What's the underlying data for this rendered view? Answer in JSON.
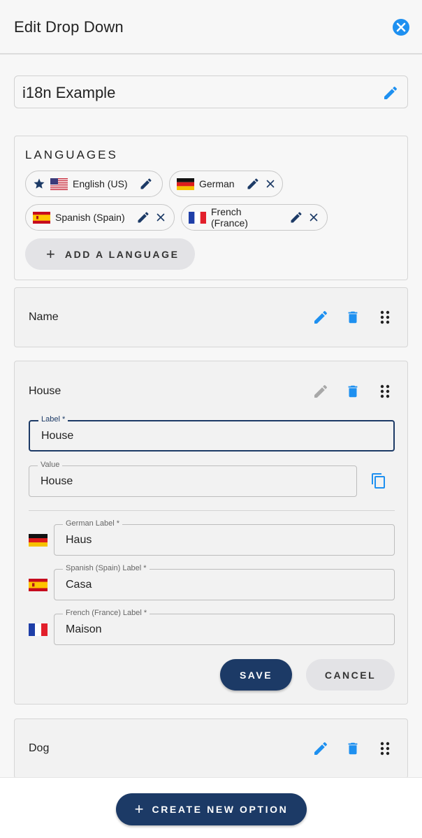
{
  "header": {
    "title": "Edit Drop Down"
  },
  "dropdown_name": {
    "value": "i18n Example"
  },
  "languages": {
    "heading": "LANGUAGES",
    "chips": [
      {
        "label": "English (US)",
        "flag": "us-flag",
        "default": true
      },
      {
        "label": "German",
        "flag": "germany-flag"
      },
      {
        "label": "Spanish (Spain)",
        "flag": "spain-flag"
      },
      {
        "label": "French (France)",
        "flag": "france-flag"
      }
    ],
    "add_button": "ADD A LANGUAGE"
  },
  "options": [
    {
      "title": "Name"
    },
    {
      "title": "House",
      "label_field": {
        "legend": "Label *",
        "value": "House"
      },
      "value_field": {
        "legend": "Value",
        "value": "House"
      },
      "translations": [
        {
          "legend": "German Label *",
          "value": "Haus",
          "flag": "germany-flag"
        },
        {
          "legend": "Spanish (Spain) Label *",
          "value": "Casa",
          "flag": "spain-flag"
        },
        {
          "legend": "French (France) Label *",
          "value": "Maison",
          "flag": "france-flag"
        }
      ],
      "save_label": "SAVE",
      "cancel_label": "CANCEL"
    },
    {
      "title": "Dog"
    }
  ],
  "footer": {
    "create_button": "CREATE NEW OPTION"
  },
  "colors": {
    "accent_blue": "#1e90f0",
    "navy": "#1c3a66",
    "disabled_icon": "#a8a8a8"
  }
}
